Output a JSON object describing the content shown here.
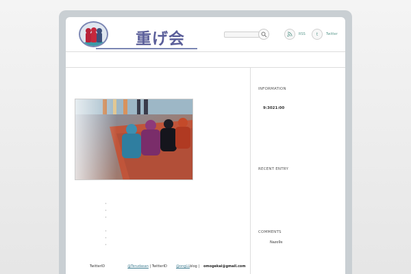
{
  "header": {
    "site_title": "重げ会",
    "search": {
      "placeholder": ""
    },
    "rss_label": "RSS",
    "twitter_label": "Twitter",
    "twitter_icon_glyph": "t"
  },
  "main": {
    "bullets": [
      "・",
      "・",
      "・",
      "・",
      "・",
      "・"
    ],
    "footer": {
      "prefix": "TwitterID",
      "link1": "@Terudasan",
      "mid": " | TwitterID",
      "link2": "@ongLL",
      "suffix": "blog |",
      "email": "omogekai@gmail.com"
    }
  },
  "sidebar": {
    "information_heading": "INFORMATION",
    "information_value": "9:3021:00",
    "recent_entry_heading": "RECENT ENTRY",
    "comments_heading": "COMMENTS",
    "comment_author": "Nazo9x"
  },
  "colors": {
    "frame": "#c9cfd3",
    "logo_text": "#5b5f9a",
    "link": "#3b7a8e",
    "social": "#5c9a8f"
  }
}
